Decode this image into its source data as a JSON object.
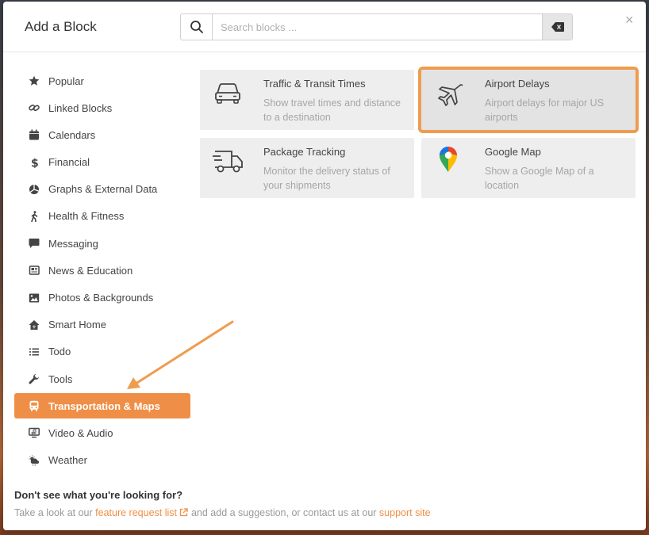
{
  "header": {
    "title": "Add a Block",
    "search_placeholder": "Search blocks ...",
    "close": "×"
  },
  "sidebar": {
    "items": [
      {
        "label": "Popular",
        "icon": "star-icon"
      },
      {
        "label": "Linked Blocks",
        "icon": "link-icon"
      },
      {
        "label": "Calendars",
        "icon": "calendar-icon"
      },
      {
        "label": "Financial",
        "icon": "dollar-icon"
      },
      {
        "label": "Graphs & External Data",
        "icon": "chart-icon"
      },
      {
        "label": "Health & Fitness",
        "icon": "walking-icon"
      },
      {
        "label": "Messaging",
        "icon": "message-icon"
      },
      {
        "label": "News & Education",
        "icon": "newspaper-icon"
      },
      {
        "label": "Photos & Backgrounds",
        "icon": "image-icon"
      },
      {
        "label": "Smart Home",
        "icon": "home-icon"
      },
      {
        "label": "Todo",
        "icon": "list-icon"
      },
      {
        "label": "Tools",
        "icon": "wrench-icon"
      },
      {
        "label": "Transportation & Maps",
        "icon": "bus-icon",
        "active": true
      },
      {
        "label": "Video & Audio",
        "icon": "monitor-icon"
      },
      {
        "label": "Weather",
        "icon": "weather-icon"
      }
    ]
  },
  "cards": [
    {
      "title": "Traffic & Transit Times",
      "desc": "Show travel times and distance to a destination",
      "icon": "car-icon"
    },
    {
      "title": "Airport Delays",
      "desc": "Airport delays for major US airports",
      "icon": "plane-icon",
      "highlighted": true
    },
    {
      "title": "Package Tracking",
      "desc": "Monitor the delivery status of your shipments",
      "icon": "truck-icon"
    },
    {
      "title": "Google Map",
      "desc": "Show a Google Map of a location",
      "icon": "map-pin-icon"
    }
  ],
  "footer": {
    "question": "Don't see what you're looking for?",
    "text_1": "Take a look at our ",
    "link_1": "feature request list",
    "text_2": " and add a suggestion, or contact us at our ",
    "link_2": "support site"
  },
  "colors": {
    "accent": "#ef8f47",
    "card_bg": "#eeeeee",
    "highlight_border": "#ef9c4f"
  }
}
